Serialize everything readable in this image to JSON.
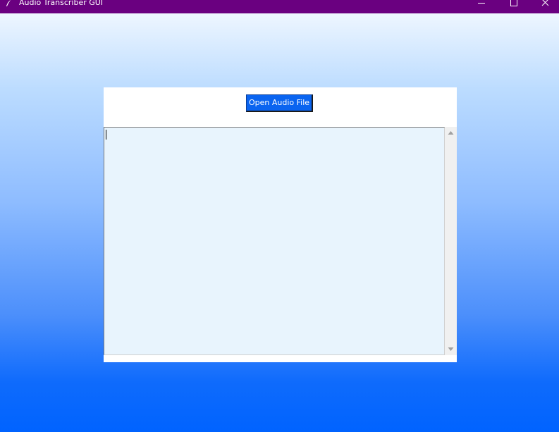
{
  "window": {
    "title": "Audio Transcriber GUI",
    "icon": "feather-icon",
    "controls": [
      "minimize-icon",
      "maximize-icon",
      "close-icon"
    ]
  },
  "main": {
    "open_button_label": "Open Audio File",
    "transcript_text": ""
  },
  "colors": {
    "titlebar": "#6a0080",
    "button": "#0a64f0",
    "text_area": "#e8f4fd",
    "background_top": "#eef6ff",
    "background_bottom": "#0063ff"
  }
}
